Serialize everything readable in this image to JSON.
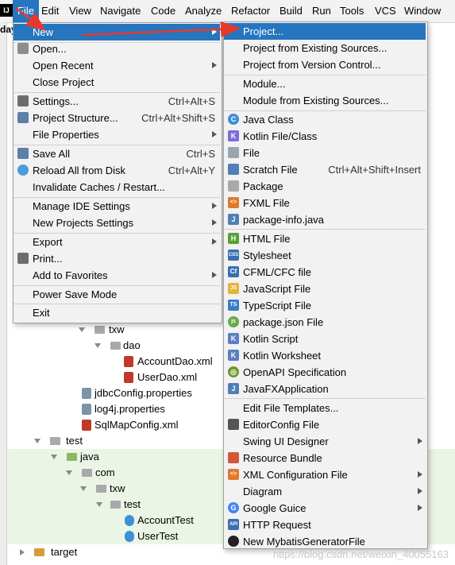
{
  "colors": {
    "accent": "#2675bf",
    "menu_bg": "#f2f2f2",
    "arrow": "#e8382b",
    "green_row": "#ebf5e6"
  },
  "menubar": {
    "items": [
      "File",
      "Edit",
      "View",
      "Navigate",
      "Code",
      "Analyze",
      "Refactor",
      "Build",
      "Run",
      "Tools",
      "VCS",
      "Window"
    ]
  },
  "breadcrumb_stub": "day",
  "file_menu": {
    "items": [
      {
        "label": "New",
        "shortcut": "",
        "submenu": true,
        "active": true,
        "icon": ""
      },
      {
        "label": "Open...",
        "shortcut": "",
        "icon": "folder-open-icon"
      },
      {
        "label": "Open Recent",
        "shortcut": "",
        "submenu": true
      },
      {
        "label": "Close Project",
        "shortcut": ""
      },
      {
        "label": "Settings...",
        "shortcut": "Ctrl+Alt+S",
        "icon": "wrench-icon"
      },
      {
        "label": "Project Structure...",
        "shortcut": "Ctrl+Alt+Shift+S",
        "icon": "project-structure-icon"
      },
      {
        "label": "File Properties",
        "shortcut": "",
        "submenu": true
      },
      {
        "label": "Save All",
        "shortcut": "Ctrl+S",
        "icon": "save-icon"
      },
      {
        "label": "Reload All from Disk",
        "shortcut": "Ctrl+Alt+Y",
        "icon": "reload-icon"
      },
      {
        "label": "Invalidate Caches / Restart...",
        "shortcut": ""
      },
      {
        "label": "Manage IDE Settings",
        "shortcut": "",
        "submenu": true
      },
      {
        "label": "New Projects Settings",
        "shortcut": "",
        "submenu": true
      },
      {
        "label": "Export",
        "shortcut": "",
        "submenu": true
      },
      {
        "label": "Print...",
        "shortcut": "",
        "icon": "print-icon"
      },
      {
        "label": "Add to Favorites",
        "shortcut": "",
        "submenu": true
      },
      {
        "label": "Power Save Mode",
        "shortcut": ""
      },
      {
        "label": "Exit",
        "shortcut": ""
      }
    ]
  },
  "new_menu": {
    "items": [
      {
        "label": "Project...",
        "active": true
      },
      {
        "label": "Project from Existing Sources..."
      },
      {
        "label": "Project from Version Control..."
      },
      {
        "label": "Module..."
      },
      {
        "label": "Module from Existing Sources..."
      },
      {
        "label": "Java Class",
        "icon": "java-class-icon",
        "icon_text": "C",
        "icon_color": "#3d8fd6"
      },
      {
        "label": "Kotlin File/Class",
        "icon": "kotlin-icon",
        "icon_text": "K",
        "icon_color": "#7f6bdc"
      },
      {
        "label": "File",
        "icon": "file-icon",
        "icon_text": "",
        "icon_color": "#9aa4ad"
      },
      {
        "label": "Scratch File",
        "shortcut": "Ctrl+Alt+Shift+Insert",
        "icon": "scratch-file-icon",
        "icon_text": "",
        "icon_color": "#4f7fb5"
      },
      {
        "label": "Package",
        "icon": "package-icon",
        "icon_text": "",
        "icon_color": "#a9a9a9"
      },
      {
        "label": "FXML File",
        "icon": "fxml-icon",
        "icon_text": "<>",
        "icon_color": "#e07a2e"
      },
      {
        "label": "package-info.java",
        "icon": "java-file-icon",
        "icon_text": "J",
        "icon_color": "#4f7fb5"
      },
      {
        "label": "HTML File",
        "icon": "html-icon",
        "icon_text": "H",
        "icon_color": "#5a9e3a"
      },
      {
        "label": "Stylesheet",
        "icon": "css-icon",
        "icon_text": "CSS",
        "icon_color": "#3a6fb0"
      },
      {
        "label": "CFML/CFC file",
        "icon": "cfml-icon",
        "icon_text": "Cf",
        "icon_color": "#3a6fb0"
      },
      {
        "label": "JavaScript File",
        "icon": "javascript-icon",
        "icon_text": "JS",
        "icon_color": "#e3b33b"
      },
      {
        "label": "TypeScript File",
        "icon": "typescript-icon",
        "icon_text": "TS",
        "icon_color": "#3b7cc4"
      },
      {
        "label": "package.json File",
        "icon": "nodejs-icon",
        "icon_text": "js",
        "icon_color": "#6aa84f"
      },
      {
        "label": "Kotlin Script",
        "icon": "kotlin-script-icon",
        "icon_text": "K",
        "icon_color": "#5a7fc4"
      },
      {
        "label": "Kotlin Worksheet",
        "icon": "kotlin-worksheet-icon",
        "icon_text": "K",
        "icon_color": "#5a7fc4"
      },
      {
        "label": "OpenAPI Specification",
        "icon": "openapi-icon",
        "icon_text": "◎",
        "icon_color": "#6f9a2e"
      },
      {
        "label": "JavaFXApplication",
        "icon": "javafx-icon",
        "icon_text": "J",
        "icon_color": "#4f7fb5"
      },
      {
        "label": "Edit File Templates..."
      },
      {
        "label": "EditorConfig File",
        "icon": "editorconfig-icon",
        "icon_text": "",
        "icon_color": "#555555"
      },
      {
        "label": "Swing UI Designer",
        "submenu": true
      },
      {
        "label": "Resource Bundle",
        "icon": "resource-bundle-icon",
        "icon_text": "",
        "icon_color": "#d0593a"
      },
      {
        "label": "XML Configuration File",
        "submenu": true,
        "icon": "xml-config-icon",
        "icon_text": "<>",
        "icon_color": "#e07a2e"
      },
      {
        "label": "Diagram",
        "submenu": true
      },
      {
        "label": "Google Guice",
        "submenu": true,
        "icon": "google-icon",
        "icon_text": "G",
        "icon_color": "#4285f4"
      },
      {
        "label": "HTTP Request",
        "icon": "api-icon",
        "icon_text": "API",
        "icon_color": "#3a6fb0"
      },
      {
        "label": "New MybatisGeneratorFile",
        "icon": "mybatis-icon",
        "icon_text": "",
        "icon_color": "#222222"
      }
    ]
  },
  "tree": {
    "rows": [
      {
        "label": "txw",
        "kind": "folder"
      },
      {
        "label": "dao",
        "kind": "folder"
      },
      {
        "label": "AccountDao.xml",
        "kind": "mybatis"
      },
      {
        "label": "UserDao.xml",
        "kind": "mybatis"
      },
      {
        "label": "jdbcConfig.properties",
        "kind": "properties"
      },
      {
        "label": "log4j.properties",
        "kind": "properties"
      },
      {
        "label": "SqlMapConfig.xml",
        "kind": "xml"
      },
      {
        "label": "test",
        "kind": "folder"
      },
      {
        "label": "java",
        "kind": "folder-green"
      },
      {
        "label": "com",
        "kind": "folder"
      },
      {
        "label": "txw",
        "kind": "folder"
      },
      {
        "label": "test",
        "kind": "folder"
      },
      {
        "label": "AccountTest",
        "kind": "class"
      },
      {
        "label": "UserTest",
        "kind": "class"
      },
      {
        "label": "target",
        "kind": "folder-orange"
      }
    ]
  },
  "watermark": "https://blog.csdn.net/weixin_40055163"
}
